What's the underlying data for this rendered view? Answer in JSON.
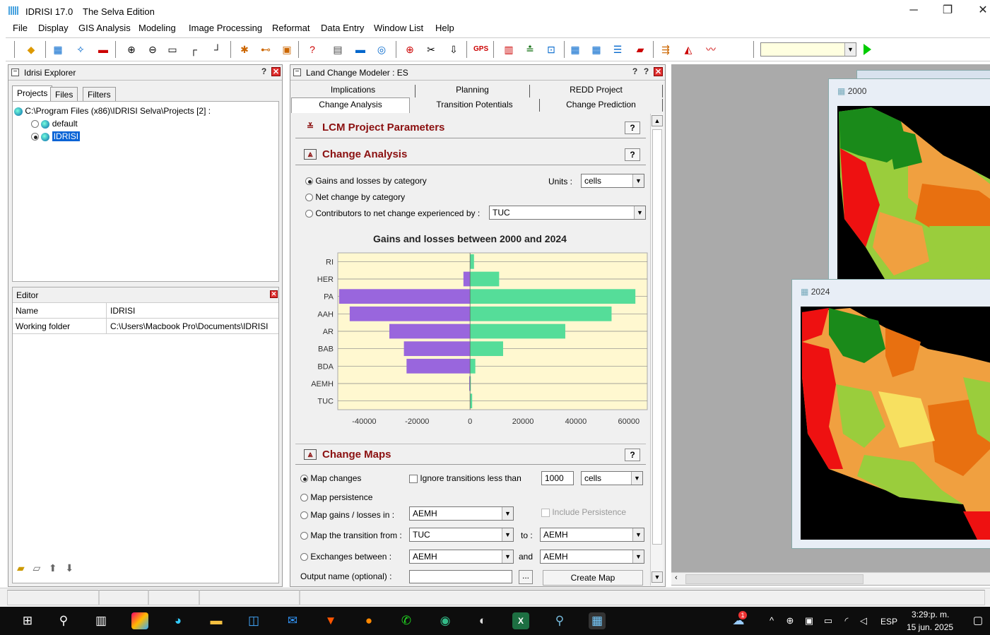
{
  "window": {
    "app_title": "IDRISI 17.0",
    "edition": "The Selva Edition"
  },
  "menu": [
    "File",
    "Display",
    "GIS Analysis",
    "Modeling",
    "Image Processing",
    "Reformat",
    "Data Entry",
    "Window List",
    "Help"
  ],
  "toolbar": {
    "combo_value": ""
  },
  "explorer": {
    "title": "Idrisi Explorer",
    "tabs": [
      "Projects",
      "Files",
      "Filters"
    ],
    "tree_root": "C:\\Program Files (x86)\\IDRISI Selva\\Projects [2] :",
    "tree_items": [
      "default",
      "IDRISI"
    ],
    "selected_item": "IDRISI",
    "editor": {
      "title": "Editor",
      "rows": [
        {
          "key": "Name",
          "value": "IDRISI"
        },
        {
          "key": "Working folder",
          "value": "C:\\Users\\Macbook Pro\\Documents\\IDRISI"
        }
      ]
    }
  },
  "lcm": {
    "title": "Land Change Modeler : ES",
    "tabs_back": [
      "Implications",
      "Planning",
      "REDD Project"
    ],
    "tabs_front": [
      "Change Analysis",
      "Transition Potentials",
      "Change Prediction"
    ],
    "active_tab": "Change Analysis",
    "project_params": "LCM Project Parameters",
    "change_analysis": {
      "title": "Change Analysis",
      "options": [
        "Gains and losses by category",
        "Net change by category",
        "Contributors to net change experienced by :"
      ],
      "selected": 0,
      "units_label": "Units :",
      "units_value": "cells",
      "contributors_value": "TUC"
    },
    "change_maps": {
      "title": "Change Maps",
      "opt_map_changes": "Map changes",
      "ignore_label": "Ignore transitions less than",
      "ignore_value": "1000",
      "ignore_units": "cells",
      "opt_persistence": "Map persistence",
      "opt_gains": "Map gains / losses in :",
      "gains_value": "AEMH",
      "include_persistence": "Include Persistence",
      "opt_transition": "Map the transition from :",
      "from_value": "TUC",
      "to_label": "to :",
      "to_value": "AEMH",
      "opt_exchanges": "Exchanges between :",
      "ex1_value": "AEMH",
      "and_label": "and",
      "ex2_value": "AEMH",
      "output_label": "Output name (optional) :",
      "browse": "...",
      "create_map": "Create Map"
    }
  },
  "chart_data": {
    "type": "bar",
    "orientation": "horizontal",
    "title": "Gains and losses between 2000 and 2024",
    "categories": [
      "RI",
      "HER",
      "PA",
      "AAH",
      "AR",
      "BAB",
      "BDA",
      "AEMH",
      "TUC"
    ],
    "series": [
      {
        "role": "losses",
        "color": "#9966dd",
        "values": [
          0,
          -2500,
          -49500,
          -45500,
          -30500,
          -25000,
          -24000,
          -300,
          0
        ]
      },
      {
        "role": "gains",
        "color": "#55dd99",
        "values": [
          1500,
          11000,
          62500,
          53500,
          36000,
          12500,
          2000,
          300,
          800
        ]
      }
    ],
    "xlim": [
      -50000,
      67000
    ],
    "xticks": [
      "-40000",
      "-20000",
      "0",
      "20000",
      "40000",
      "60000"
    ],
    "xtick_values": [
      -40000,
      -20000,
      0,
      20000,
      40000,
      60000
    ],
    "grid": true
  },
  "maps": [
    {
      "title": "2000"
    },
    {
      "title": "2024"
    }
  ],
  "taskbar": {
    "lang": "ESP",
    "time": "3:29:p. m.",
    "date": "15 jun. 2025",
    "badge": "1"
  }
}
